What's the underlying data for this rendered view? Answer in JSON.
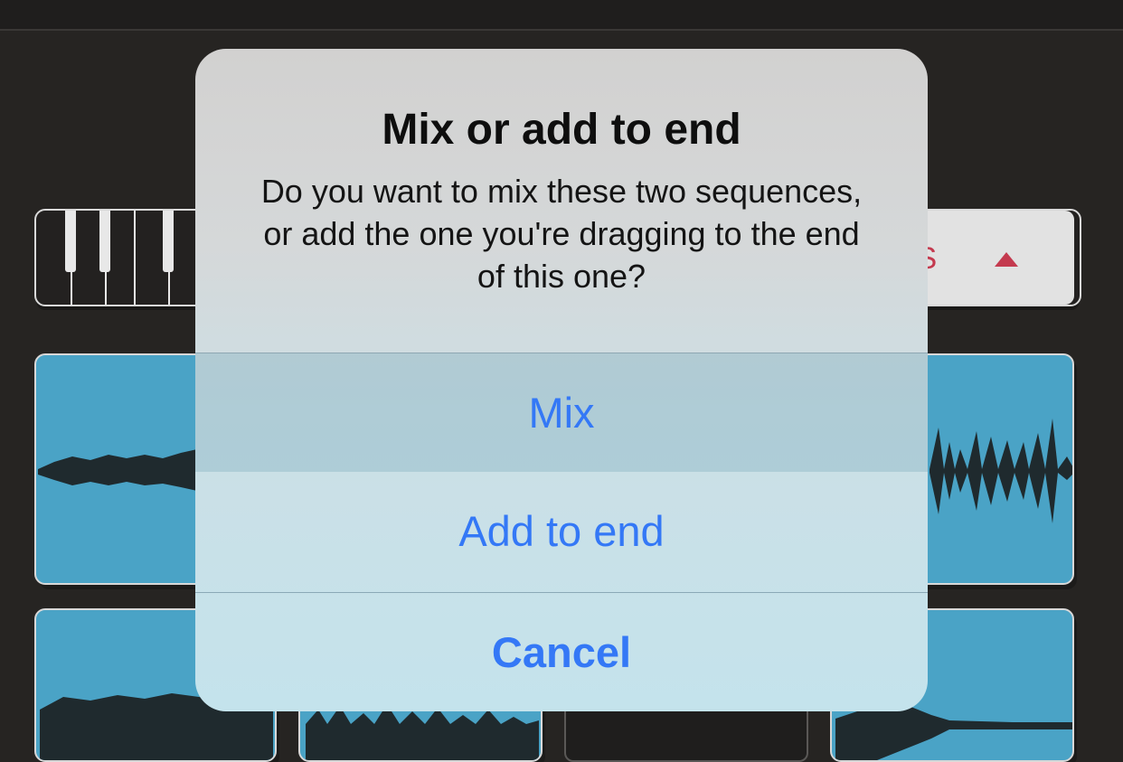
{
  "dialog": {
    "title": "Mix or add to end",
    "message": "Do you want to mix these two sequences, or add the one you're dragging to the end of this one?",
    "buttons": {
      "mix": "Mix",
      "add_to_end": "Add to end",
      "cancel": "Cancel"
    }
  },
  "background": {
    "tracks_button_label_visible": "RS",
    "accent_color": "#c43a4f",
    "clip_color": "#4aa3c6",
    "link_color": "#3478f6"
  }
}
